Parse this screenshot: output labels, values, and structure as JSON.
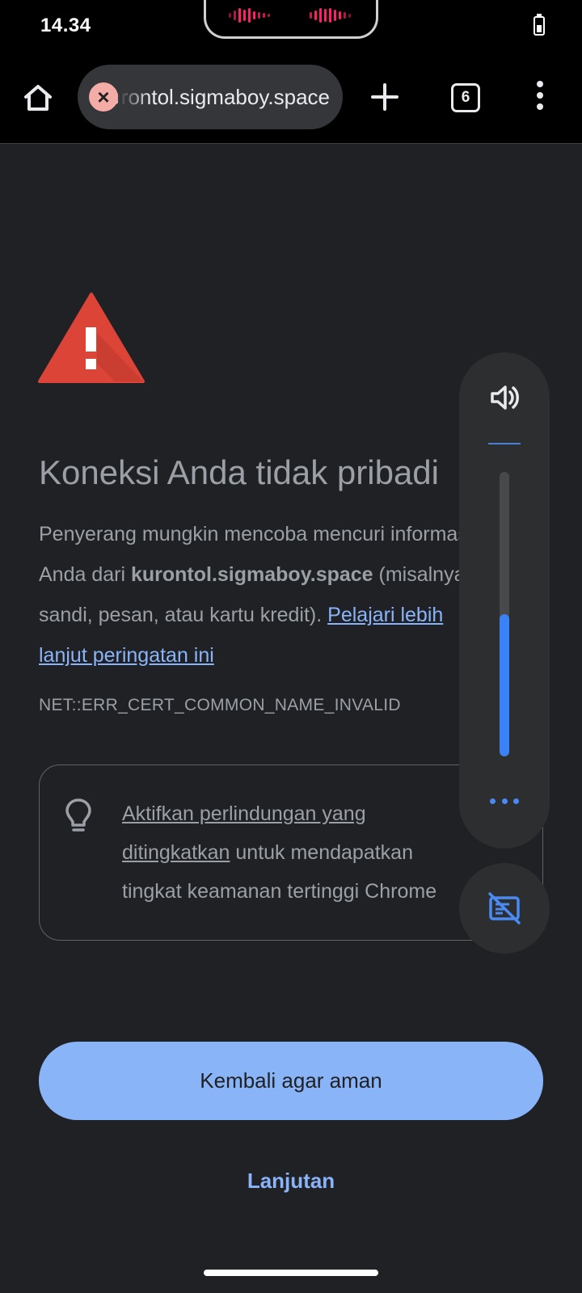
{
  "status_bar": {
    "time": "14.34",
    "battery_icon": "battery-icon"
  },
  "toolbar": {
    "home_icon": "home-icon",
    "url": "kurontol.sigmaboy.space",
    "url_status_icon": "not-secure-error-icon",
    "new_tab_icon": "plus-icon",
    "tab_count": "6",
    "menu_icon": "more-vert-icon"
  },
  "interstitial": {
    "warning_icon": "warning-triangle-icon",
    "heading": "Koneksi Anda tidak pribadi",
    "body": {
      "line1": "Penyerang mungkin mencoba mencuri informasi",
      "line2_prefix": "Anda dari ",
      "domain": "kurontol.sigmaboy.space",
      "line2_suffix": " (misalnya,",
      "line3_prefix": "sandi, pesan, atau kartu kredit). ",
      "learn_more_part1": "Pelajari lebih",
      "learn_more_part2": "lanjut peringatan ini"
    },
    "error_code": "NET::ERR_CERT_COMMON_NAME_INVALID",
    "tip": {
      "icon": "lightbulb-icon",
      "link_part1": "Aktifkan perlindungan yang",
      "link_part2": "ditingkatkan",
      "text_after_link": " untuk mendapatkan",
      "line3": "tingkat keamanan tertinggi Chrome"
    },
    "back_button": "Kembali agar aman",
    "advanced_button": "Lanjutan"
  },
  "volume_overlay": {
    "speaker_icon": "volume-up-icon",
    "level_fraction": 0.5,
    "more_icon": "more-horiz-icon",
    "caption_icon": "live-caption-off-icon",
    "accent": "#3b82f6"
  },
  "colors": {
    "background": "#202124",
    "text_secondary": "#9aa0a6",
    "link": "#8ab4f8",
    "warning_red": "#db4437",
    "button_primary": "#8ab4f8"
  }
}
